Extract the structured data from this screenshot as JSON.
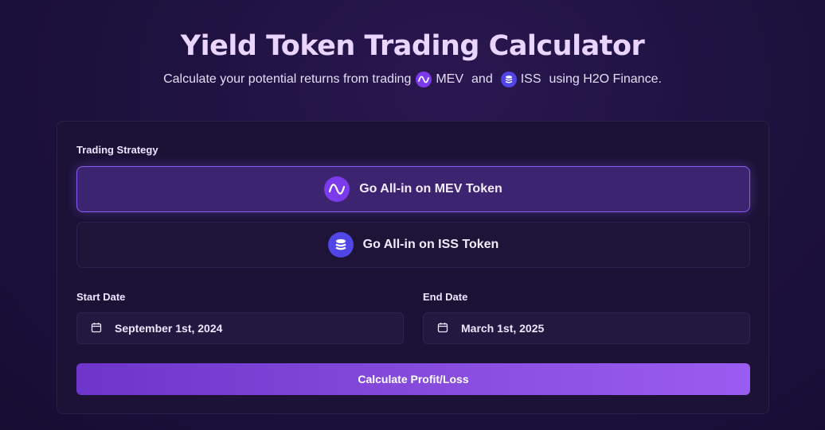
{
  "header": {
    "title": "Yield Token Trading Calculator",
    "subtitle_prefix": "Calculate your potential returns from trading",
    "token_a": "MEV",
    "conjunction": "and",
    "token_b": "ISS",
    "subtitle_suffix": "using H2O Finance."
  },
  "form": {
    "strategy_label": "Trading Strategy",
    "strategies": [
      {
        "label": "Go All-in on MEV Token",
        "icon": "wave-icon",
        "selected": true
      },
      {
        "label": "Go All-in on ISS Token",
        "icon": "coins-stack-icon",
        "selected": false
      }
    ],
    "start_date": {
      "label": "Start Date",
      "value": "September 1st, 2024",
      "icon": "calendar-icon"
    },
    "end_date": {
      "label": "End Date",
      "value": "March 1st, 2025",
      "icon": "calendar-icon"
    },
    "submit_label": "Calculate Profit/Loss"
  },
  "colors": {
    "accent": "#8b5cf6",
    "title": "#e9d5ff",
    "mev": "#7c3aed",
    "iss": "#4f46e5",
    "background": "#1e1240"
  }
}
